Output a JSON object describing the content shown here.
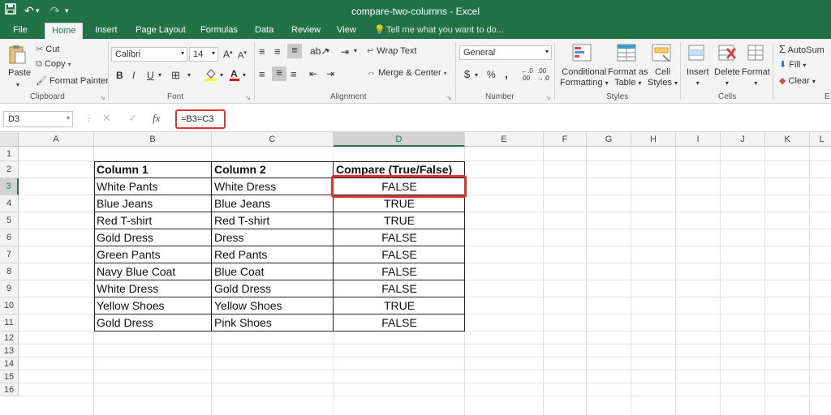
{
  "window": {
    "title": "compare-two-columns - Excel"
  },
  "qat": {
    "save_icon": "save-icon",
    "undo_icon": "undo-icon",
    "redo_icon": "redo-icon"
  },
  "tabs": [
    "File",
    "Home",
    "Insert",
    "Page Layout",
    "Formulas",
    "Data",
    "Review",
    "View"
  ],
  "tell_me": "Tell me what you want to do...",
  "ribbon": {
    "clipboard": {
      "paste": "Paste",
      "cut": "Cut",
      "copy": "Copy",
      "format_painter": "Format Painter",
      "label": "Clipboard"
    },
    "font": {
      "name": "Calibri",
      "size": "14",
      "bold": "B",
      "italic": "I",
      "underline": "U",
      "label": "Font"
    },
    "alignment": {
      "wrap": "Wrap Text",
      "merge": "Merge & Center",
      "label": "Alignment"
    },
    "number": {
      "format": "General",
      "currency": "$",
      "percent": "%",
      "comma": ",",
      "label": "Number"
    },
    "styles": {
      "conditional": "Conditional",
      "formatting": "Formatting",
      "format_as": "Format as",
      "table": "Table",
      "cell": "Cell",
      "cell_styles": "Styles",
      "label": "Styles"
    },
    "cells": {
      "insert": "Insert",
      "delete": "Delete",
      "format": "Format",
      "label": "Cells"
    },
    "editing": {
      "autosum": "AutoSum",
      "fill": "Fill",
      "clear": "Clear",
      "label": "E"
    }
  },
  "formula_bar": {
    "name_box": "D3",
    "fx": "fx",
    "formula": "=B3=C3"
  },
  "columns": [
    "A",
    "B",
    "C",
    "D",
    "E",
    "F",
    "G",
    "H",
    "I",
    "J",
    "K",
    "L"
  ],
  "rows": [
    "1",
    "2",
    "3",
    "4",
    "5",
    "6",
    "7",
    "8",
    "9",
    "10",
    "11",
    "12",
    "13",
    "14",
    "15",
    "16"
  ],
  "selected": {
    "column": "D",
    "row": "3"
  },
  "table": {
    "headers": [
      "Column 1",
      "Column 2",
      "Compare  (True/False)"
    ],
    "data": [
      [
        "White Pants",
        "White Dress",
        "FALSE"
      ],
      [
        "Blue Jeans",
        "Blue Jeans",
        "TRUE"
      ],
      [
        "Red T-shirt",
        "Red T-shirt",
        "TRUE"
      ],
      [
        "Gold Dress",
        "Dress",
        "FALSE"
      ],
      [
        "Green Pants",
        "Red Pants",
        "FALSE"
      ],
      [
        "Navy Blue Coat",
        "Blue Coat",
        "FALSE"
      ],
      [
        "White Dress",
        "Gold Dress",
        "FALSE"
      ],
      [
        "Yellow Shoes",
        "Yellow Shoes",
        "TRUE"
      ],
      [
        "Gold Dress",
        "Pink Shoes",
        "FALSE"
      ]
    ]
  },
  "colors": {
    "accent": "#217346",
    "highlight": "#d33333"
  }
}
